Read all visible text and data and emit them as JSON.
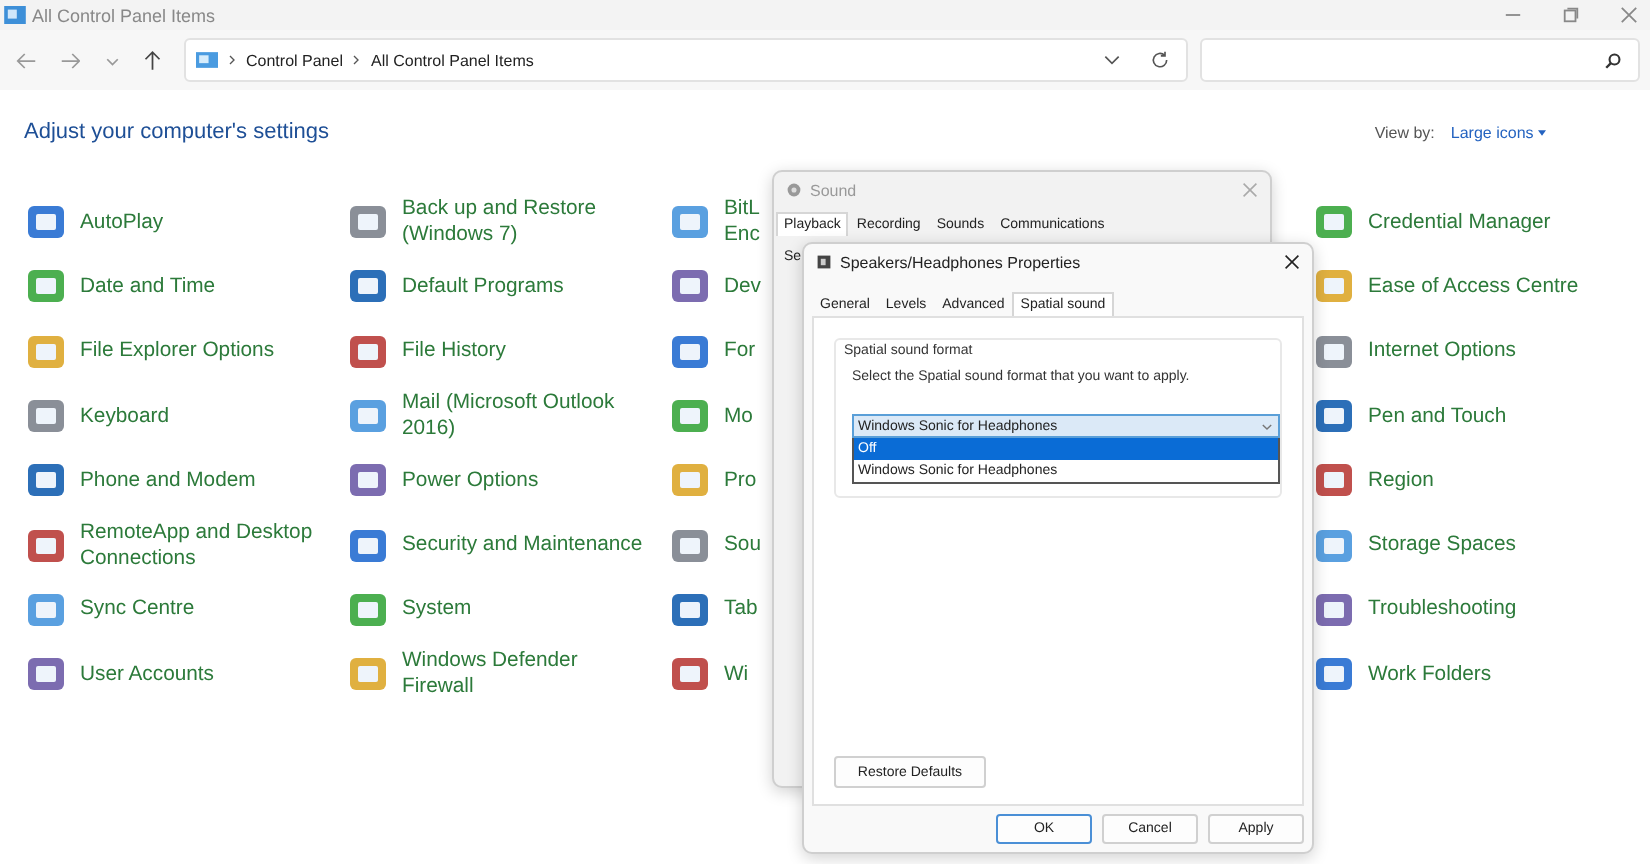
{
  "window": {
    "title": "All Control Panel Items"
  },
  "address_bar": {
    "breadcrumbs": [
      "Control Panel",
      "All Control Panel Items"
    ]
  },
  "heading": "Adjust your computer's settings",
  "view_by": {
    "label": "View by:",
    "value": "Large icons"
  },
  "columns": [
    [
      {
        "lines": [
          "AutoPlay"
        ]
      },
      {
        "lines": [
          "Date and Time"
        ]
      },
      {
        "lines": [
          "File Explorer Options"
        ]
      },
      {
        "lines": [
          "Keyboard"
        ]
      },
      {
        "lines": [
          "Phone and Modem"
        ]
      },
      {
        "lines": [
          "RemoteApp and Desktop",
          "Connections"
        ]
      },
      {
        "lines": [
          "Sync Centre"
        ]
      },
      {
        "lines": [
          "User Accounts"
        ]
      }
    ],
    [
      {
        "lines": [
          "Back up and Restore",
          "(Windows 7)"
        ]
      },
      {
        "lines": [
          "Default Programs"
        ]
      },
      {
        "lines": [
          "File History"
        ]
      },
      {
        "lines": [
          "Mail (Microsoft Outlook",
          "2016)"
        ]
      },
      {
        "lines": [
          "Power Options"
        ]
      },
      {
        "lines": [
          "Security and Maintenance"
        ]
      },
      {
        "lines": [
          "System"
        ]
      },
      {
        "lines": [
          "Windows Defender",
          "Firewall"
        ]
      }
    ],
    [
      {
        "lines": [
          "BitL",
          "Enc"
        ]
      },
      {
        "lines": [
          "Dev"
        ]
      },
      {
        "lines": [
          "For"
        ]
      },
      {
        "lines": [
          "Mo"
        ]
      },
      {
        "lines": [
          "Pro"
        ]
      },
      {
        "lines": [
          "Sou"
        ]
      },
      {
        "lines": [
          "Tab"
        ]
      },
      {
        "lines": [
          "Wi"
        ]
      }
    ],
    [
      {
        "lines": [
          "Credential Manager"
        ]
      },
      {
        "lines": [
          "Ease of Access Centre"
        ]
      },
      {
        "lines": [
          "Internet Options"
        ]
      },
      {
        "lines": [
          "Pen and Touch"
        ]
      },
      {
        "lines": [
          "Region"
        ]
      },
      {
        "lines": [
          "Storage Spaces"
        ]
      },
      {
        "lines": [
          "Troubleshooting"
        ]
      },
      {
        "lines": [
          "Work Folders"
        ]
      }
    ]
  ],
  "sound_dialog": {
    "title": "Sound",
    "fragment": "Se",
    "tabs": [
      {
        "label": "Playback",
        "selected": true
      },
      {
        "label": "Recording",
        "selected": false
      },
      {
        "label": "Sounds",
        "selected": false
      },
      {
        "label": "Communications",
        "selected": false
      }
    ]
  },
  "properties_dialog": {
    "title": "Speakers/Headphones Properties",
    "tabs": [
      {
        "label": "General",
        "selected": false
      },
      {
        "label": "Levels",
        "selected": false
      },
      {
        "label": "Advanced",
        "selected": false
      },
      {
        "label": "Spatial sound",
        "selected": true
      }
    ],
    "group_title": "Spatial sound format",
    "description": "Select the Spatial sound format that you want to apply.",
    "combo": {
      "value": "Windows Sonic for Headphones",
      "options": [
        {
          "label": "Off",
          "highlighted": true
        },
        {
          "label": "Windows Sonic for Headphones",
          "highlighted": false
        }
      ]
    },
    "restore_button": "Restore Defaults",
    "buttons": [
      {
        "label": "OK",
        "default": true
      },
      {
        "label": "Cancel",
        "default": false
      },
      {
        "label": "Apply",
        "default": false
      }
    ]
  }
}
